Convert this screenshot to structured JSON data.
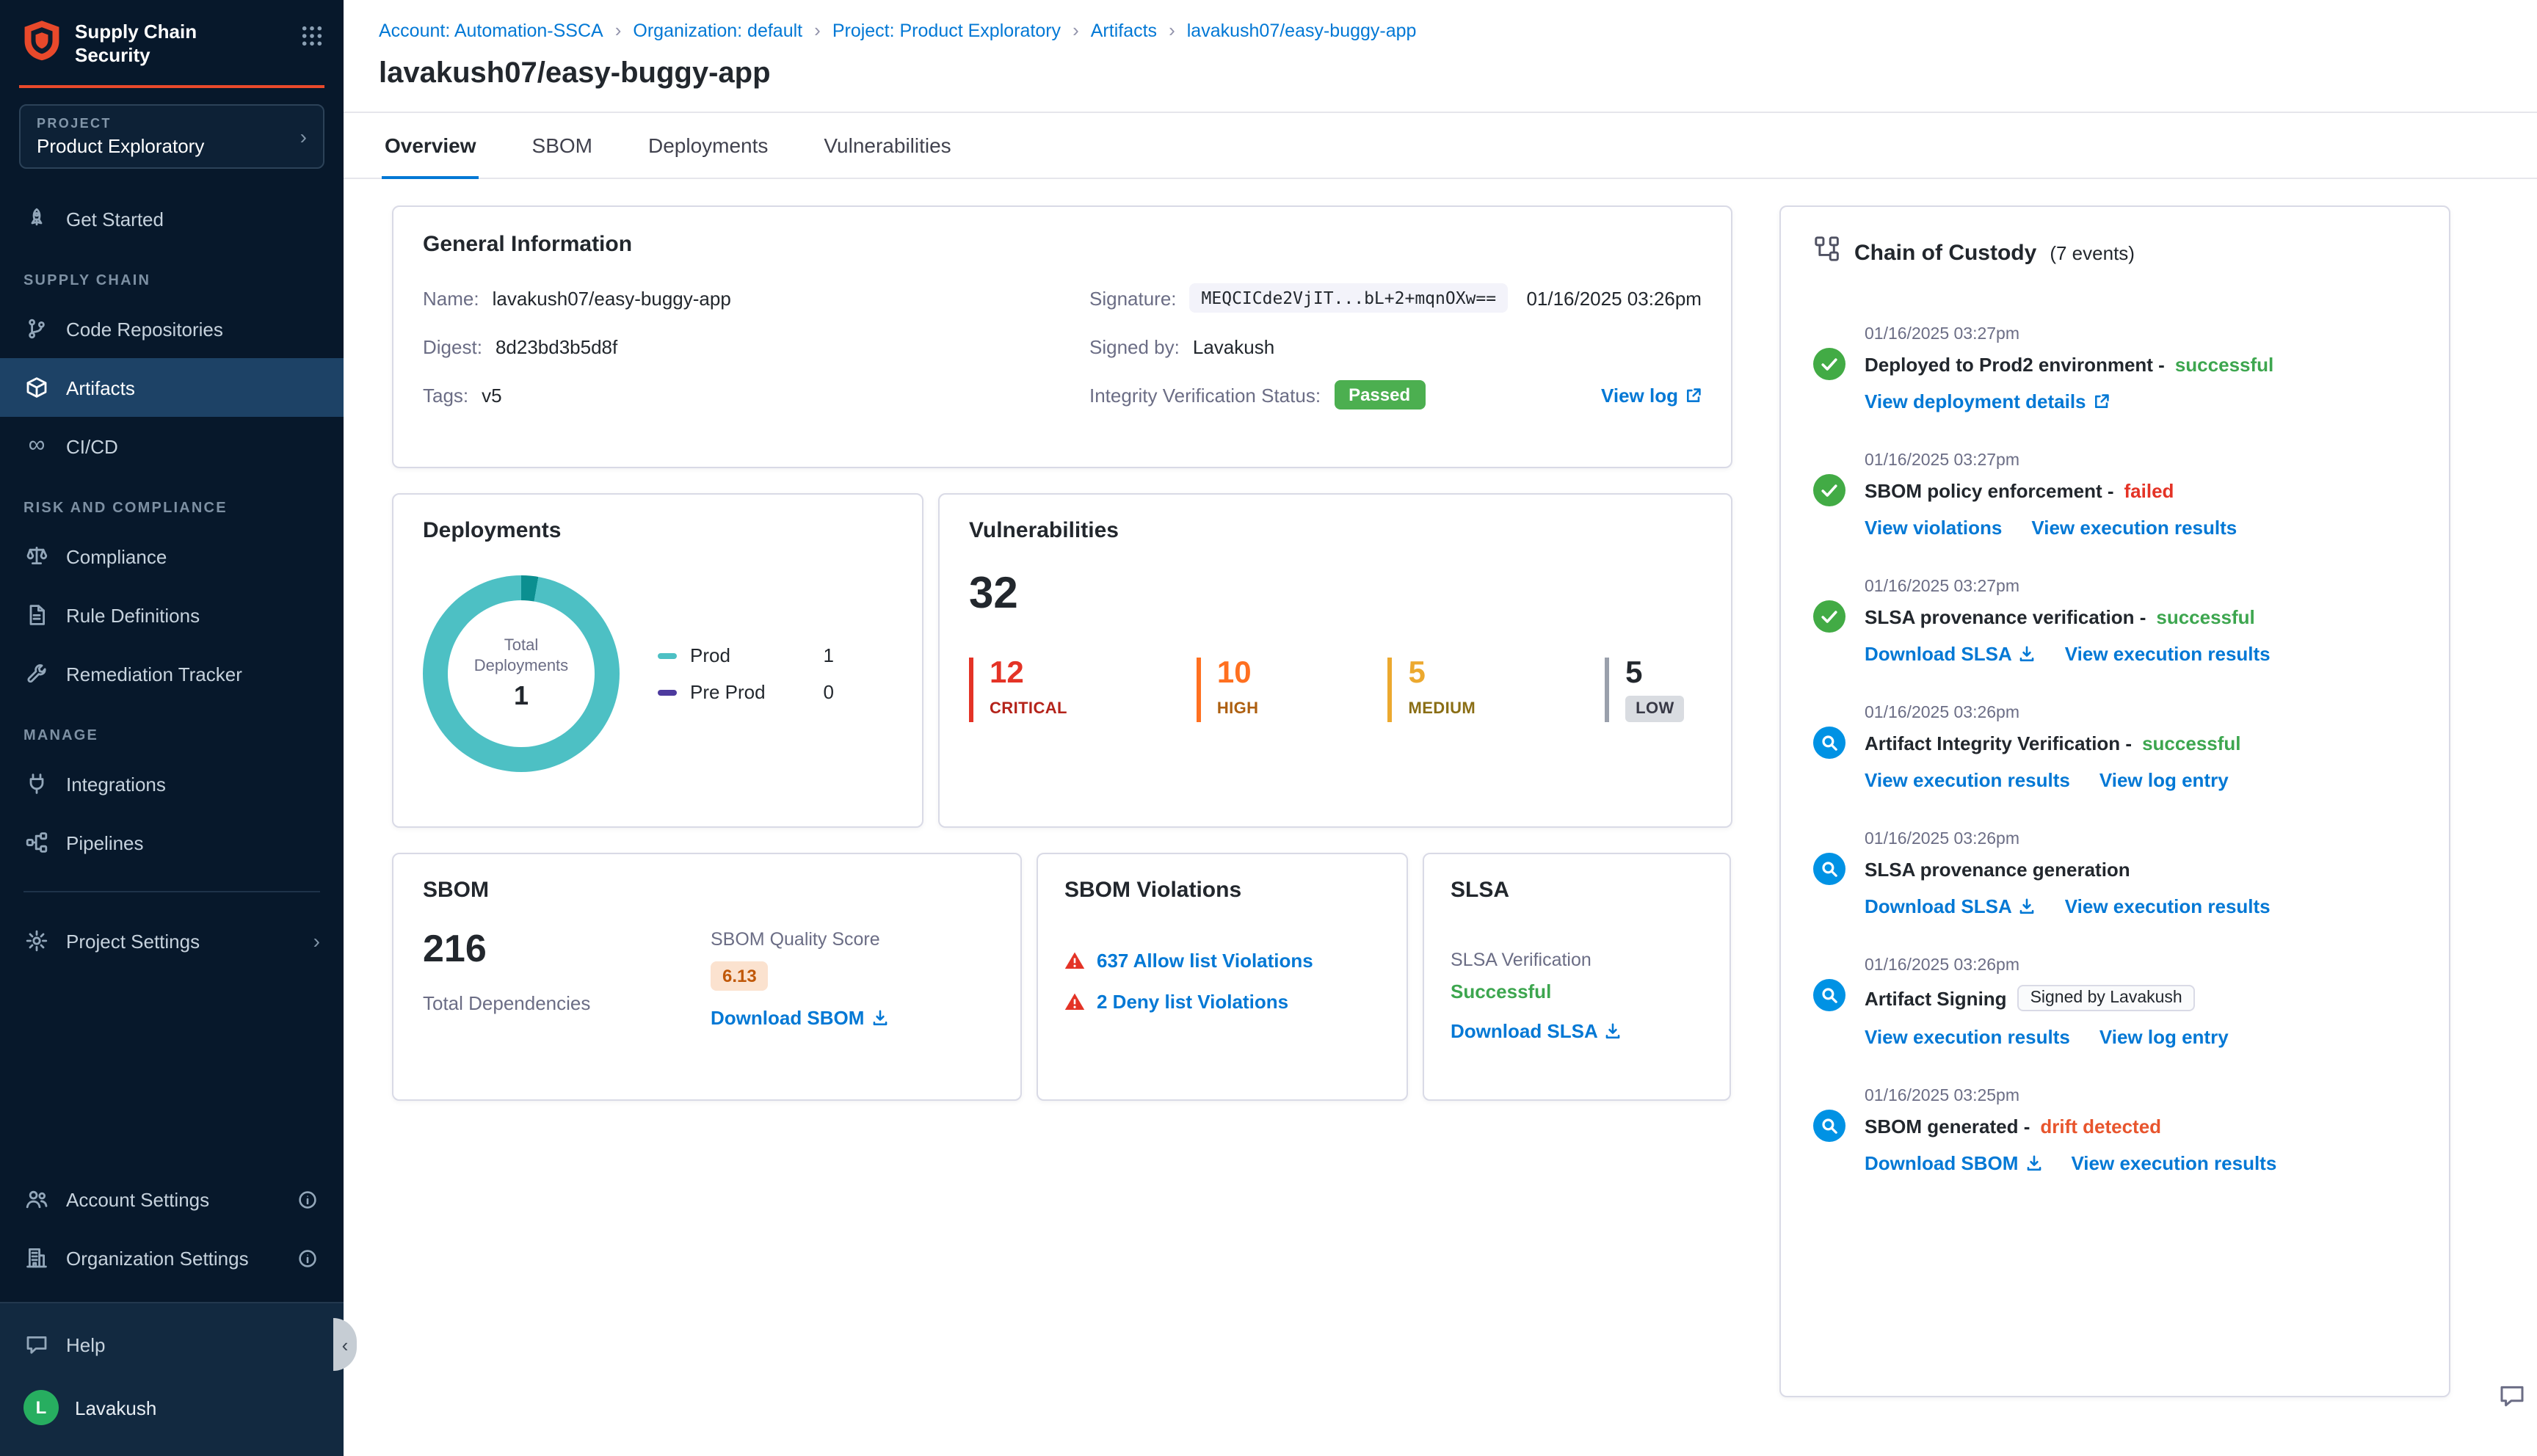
{
  "sidebar": {
    "brand_line1": "Supply Chain",
    "brand_line2": "Security",
    "project_label": "PROJECT",
    "project_name": "Product Exploratory",
    "sections": {
      "supply_chain": "SUPPLY CHAIN",
      "risk_and_compliance": "RISK AND COMPLIANCE",
      "manage": "MANAGE"
    },
    "items": {
      "get_started": "Get Started",
      "code_repositories": "Code Repositories",
      "artifacts": "Artifacts",
      "cicd": "CI/CD",
      "compliance": "Compliance",
      "rule_definitions": "Rule Definitions",
      "remediation_tracker": "Remediation Tracker",
      "integrations": "Integrations",
      "pipelines": "Pipelines",
      "project_settings": "Project Settings",
      "account_settings": "Account Settings",
      "organization_settings": "Organization Settings",
      "help": "Help"
    },
    "user": {
      "initial": "L",
      "name": "Lavakush"
    }
  },
  "breadcrumb": [
    "Account: Automation-SSCA",
    "Organization: default",
    "Project: Product Exploratory",
    "Artifacts",
    "lavakush07/easy-buggy-app"
  ],
  "page_title": "lavakush07/easy-buggy-app",
  "tabs": [
    "Overview",
    "SBOM",
    "Deployments",
    "Vulnerabilities"
  ],
  "general_info": {
    "title": "General Information",
    "name_label": "Name:",
    "name_value": "lavakush07/easy-buggy-app",
    "digest_label": "Digest:",
    "digest_value": "8d23bd3b5d8f",
    "tags_label": "Tags:",
    "tags_value": "v5",
    "signature_label": "Signature:",
    "signature_value": "MEQCICde2VjIT...bL+2+mqnOXw==",
    "signature_date": "01/16/2025 03:26pm",
    "signed_by_label": "Signed by:",
    "signed_by_value": "Lavakush",
    "integrity_label": "Integrity Verification Status:",
    "integrity_value": "Passed",
    "view_log": "View log"
  },
  "deployments_card": {
    "title": "Deployments",
    "center_label": "Total Deployments",
    "center_value": "1",
    "legend": [
      {
        "name": "Prod",
        "value": "1"
      },
      {
        "name": "Pre Prod",
        "value": "0"
      }
    ]
  },
  "vulnerabilities_card": {
    "title": "Vulnerabilities",
    "total": "32",
    "severities": [
      {
        "label": "CRITICAL",
        "count": "12"
      },
      {
        "label": "HIGH",
        "count": "10"
      },
      {
        "label": "MEDIUM",
        "count": "5"
      },
      {
        "label": "LOW",
        "count": "5"
      }
    ]
  },
  "sbom_card": {
    "title": "SBOM",
    "total": "216",
    "total_label": "Total Dependencies",
    "quality_label": "SBOM Quality Score",
    "quality_score": "6.13",
    "download_label": "Download SBOM"
  },
  "sbom_violations_card": {
    "title": "SBOM Violations",
    "allow_list": "637 Allow list Violations",
    "deny_list": "2 Deny list Violations"
  },
  "slsa_card": {
    "title": "SLSA",
    "verification_label": "SLSA Verification",
    "status": "Successful",
    "download_label": "Download SLSA"
  },
  "chain_of_custody": {
    "title": "Chain of Custody",
    "count": "(7 events)",
    "events": [
      {
        "time": "01/16/2025 03:27pm",
        "title": "Deployed to Prod2 environment -",
        "status": "successful",
        "links": [
          {
            "label": "View deployment details"
          }
        ]
      },
      {
        "time": "01/16/2025 03:27pm",
        "title": "SBOM policy enforcement -",
        "status": "failed",
        "links": [
          {
            "label": "View violations"
          },
          {
            "label": "View execution results"
          }
        ]
      },
      {
        "time": "01/16/2025 03:27pm",
        "title": "SLSA provenance verification -",
        "status": "successful",
        "links": [
          {
            "label": "Download SLSA"
          },
          {
            "label": "View execution results"
          }
        ]
      },
      {
        "time": "01/16/2025 03:26pm",
        "title": "Artifact Integrity Verification -",
        "status": "successful",
        "links": [
          {
            "label": "View execution results"
          },
          {
            "label": "View log entry"
          }
        ]
      },
      {
        "time": "01/16/2025 03:26pm",
        "title": "SLSA provenance generation",
        "status": "",
        "links": [
          {
            "label": "Download SLSA"
          },
          {
            "label": "View execution results"
          }
        ]
      },
      {
        "time": "01/16/2025 03:26pm",
        "title": "Artifact Signing",
        "status": "",
        "badge": "Signed by Lavakush",
        "links": [
          {
            "label": "View execution results"
          },
          {
            "label": "View log entry"
          }
        ]
      },
      {
        "time": "01/16/2025 03:25pm",
        "title": "SBOM generated -",
        "status": "drift detected",
        "links": [
          {
            "label": "Download SBOM"
          },
          {
            "label": "View execution results"
          }
        ]
      }
    ]
  },
  "chart_data": [
    {
      "type": "pie",
      "title": "Total Deployments",
      "series": [
        {
          "name": "Prod",
          "value": 1
        },
        {
          "name": "Pre Prod",
          "value": 0
        }
      ],
      "center_total": 1,
      "legend_position": "right"
    },
    {
      "type": "bar",
      "title": "Vulnerabilities",
      "categories": [
        "CRITICAL",
        "HIGH",
        "MEDIUM",
        "LOW"
      ],
      "values": [
        12,
        10,
        5,
        5
      ],
      "total": 32
    }
  ],
  "colors": {
    "accent_blue": "#0278D5",
    "sidebar_bg": "#07182B",
    "module_accent": "#E8492B",
    "success_green": "#3DA64F",
    "failed_red": "#E43326",
    "drift_orange": "#E8552D",
    "critical": "#E43326",
    "high": "#FF7020",
    "medium": "#ECA92F",
    "prod_teal": "#4DC0C4",
    "preprod_purple": "#4D3A9E",
    "passed_badge_green": "#4CAF50"
  }
}
